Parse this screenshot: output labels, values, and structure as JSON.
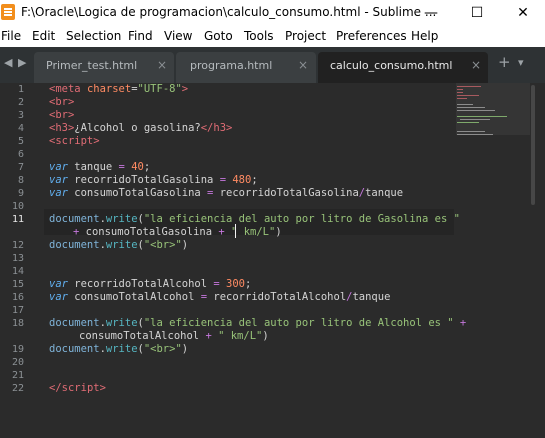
{
  "window": {
    "title": "F:\\Oracle\\Logica de programacion\\calculo_consumo.html - Sublime ...",
    "app_icon": "sublime-text-icon",
    "minimize_glyph": "—",
    "maximize_glyph": "☐",
    "close_glyph": "✕"
  },
  "menu": {
    "items": [
      "File",
      "Edit",
      "Selection",
      "Find",
      "View",
      "Goto",
      "Tools",
      "Project",
      "Preferences",
      "Help"
    ]
  },
  "tabs": {
    "nav_left": "◀",
    "nav_right": "▶",
    "items": [
      {
        "label": "Primer_test.html",
        "close": "×",
        "active": false
      },
      {
        "label": "programa.html",
        "close": "×",
        "active": false
      },
      {
        "label": "calculo_consumo.html",
        "close": "×",
        "active": true
      }
    ],
    "new_tab": "+",
    "more": "▾"
  },
  "editor": {
    "line_numbers": [
      "1",
      "2",
      "3",
      "4",
      "5",
      "6",
      "7",
      "8",
      "9",
      "10",
      "11",
      "",
      "12",
      "13",
      "14",
      "15",
      "16",
      "17",
      "18",
      "",
      "19",
      "20",
      "21",
      "22"
    ],
    "current_line": "11",
    "colors": {
      "background": "#2b2b2b",
      "tag": "#e06c75",
      "string": "#98c379",
      "keyword": "#61afef",
      "number": "#ff8b63"
    },
    "code": {
      "l1_tag_open": "<",
      "l1_tag": "meta",
      "l1_attr": " charset",
      "l1_eq": "=",
      "l1_val": "\"UTF-8\"",
      "l1_close": ">",
      "l2": "<br>",
      "l3": "<br>",
      "l4_open": "<h3>",
      "l4_text": "¿Alcohol o gasolina?",
      "l4_close": "</h3>",
      "l5": "<script>",
      "l7_kw": "var",
      "l7_name": " tanque ",
      "l7_op": "=",
      "l7_num": " 40",
      "l7_end": ";",
      "l8_kw": "var",
      "l8_name": " recorridoTotalGasolina ",
      "l8_op": "=",
      "l8_num": " 480",
      "l8_end": ";",
      "l9_kw": "var",
      "l9_name": " consumoTotalGasolina ",
      "l9_op": "=",
      "l9_expr_a": " recorridoTotalGasolina",
      "l9_slash": "/",
      "l9_expr_b": "tanque",
      "l11_obj": "document",
      "l11_dot": ".",
      "l11_fn": "write",
      "l11_paren": "(",
      "l11_str": "\"la eficiencia del auto por litro de Gasolina es \"",
      "l11b_plus": "+",
      "l11b_var": " consumoTotalGasolina ",
      "l11b_plus2": "+",
      "l11b_str": " \" km/L\"",
      "l11b_paren": ")",
      "l12_obj": "document",
      "l12_dot": ".",
      "l12_fn": "write",
      "l12_open": "(",
      "l12_str": "\"<br>\"",
      "l12_close": ")",
      "l15_kw": "var",
      "l15_name": " recorridoTotalAlcohol ",
      "l15_op": "=",
      "l15_num": " 300",
      "l15_end": ";",
      "l16_kw": "var",
      "l16_name": " consumoTotalAlcohol ",
      "l16_op": "=",
      "l16_expr_a": " recorridoTotalAlcohol",
      "l16_slash": "/",
      "l16_expr_b": "tanque",
      "l18_obj": "document",
      "l18_dot": ".",
      "l18_fn": "write",
      "l18_paren": "(",
      "l18_str": "\"la eficiencia del auto por litro de Alcohol es \"",
      "l18_plus": " +",
      "l18b_var": "consumoTotalAlcohol ",
      "l18b_plus": "+",
      "l18b_str": " \" km/L\"",
      "l18b_paren": ")",
      "l19_obj": "document",
      "l19_dot": ".",
      "l19_fn": "write",
      "l19_open": "(",
      "l19_str": "\"<br>\"",
      "l19_close": ")",
      "l22_open": "</",
      "l22_tag": "script",
      "l22_close": ">"
    }
  }
}
